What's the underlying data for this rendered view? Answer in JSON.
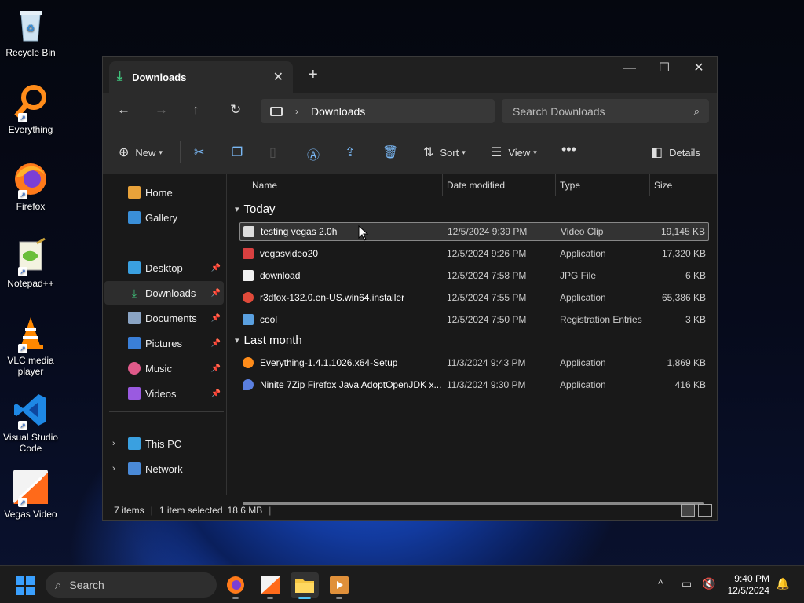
{
  "desktop": {
    "icons": [
      {
        "label": "Recycle Bin"
      },
      {
        "label": "Everything"
      },
      {
        "label": "Firefox"
      },
      {
        "label": "Notepad++"
      },
      {
        "label": "VLC media player"
      },
      {
        "label": "Visual Studio Code"
      },
      {
        "label": "Vegas Video"
      }
    ]
  },
  "window": {
    "tab_title": "Downloads",
    "address_segment": "Downloads",
    "search_placeholder": "Search Downloads",
    "toolbar": {
      "new_label": "New",
      "sort_label": "Sort",
      "view_label": "View",
      "details_label": "Details"
    },
    "sidebar": {
      "home": "Home",
      "gallery": "Gallery",
      "desktop": "Desktop",
      "downloads": "Downloads",
      "documents": "Documents",
      "pictures": "Pictures",
      "music": "Music",
      "videos": "Videos",
      "this_pc": "This PC",
      "network": "Network"
    },
    "columns": {
      "name": "Name",
      "date": "Date modified",
      "type": "Type",
      "size": "Size"
    },
    "groups": {
      "today": "Today",
      "last_month": "Last month"
    },
    "files": [
      {
        "name": "testing vegas 2.0h",
        "date": "12/5/2024 9:39 PM",
        "type": "Video Clip",
        "size": "19,145 KB"
      },
      {
        "name": "vegasvideo20",
        "date": "12/5/2024 9:26 PM",
        "type": "Application",
        "size": "17,320 KB"
      },
      {
        "name": "download",
        "date": "12/5/2024 7:58 PM",
        "type": "JPG File",
        "size": "6 KB"
      },
      {
        "name": "r3dfox-132.0.en-US.win64.installer",
        "date": "12/5/2024 7:55 PM",
        "type": "Application",
        "size": "65,386 KB"
      },
      {
        "name": "cool",
        "date": "12/5/2024 7:50 PM",
        "type": "Registration Entries",
        "size": "3 KB"
      },
      {
        "name": "Everything-1.4.1.1026.x64-Setup",
        "date": "11/3/2024 9:43 PM",
        "type": "Application",
        "size": "1,869 KB"
      },
      {
        "name": "Ninite 7Zip Firefox Java AdoptOpenJDK x...",
        "date": "11/3/2024 9:30 PM",
        "type": "Application",
        "size": "416 KB"
      }
    ],
    "status": {
      "items": "7 items",
      "selected": "1 item selected",
      "size": "18.6 MB"
    }
  },
  "taskbar": {
    "search_label": "Search",
    "time": "9:40 PM",
    "date": "12/5/2024"
  }
}
